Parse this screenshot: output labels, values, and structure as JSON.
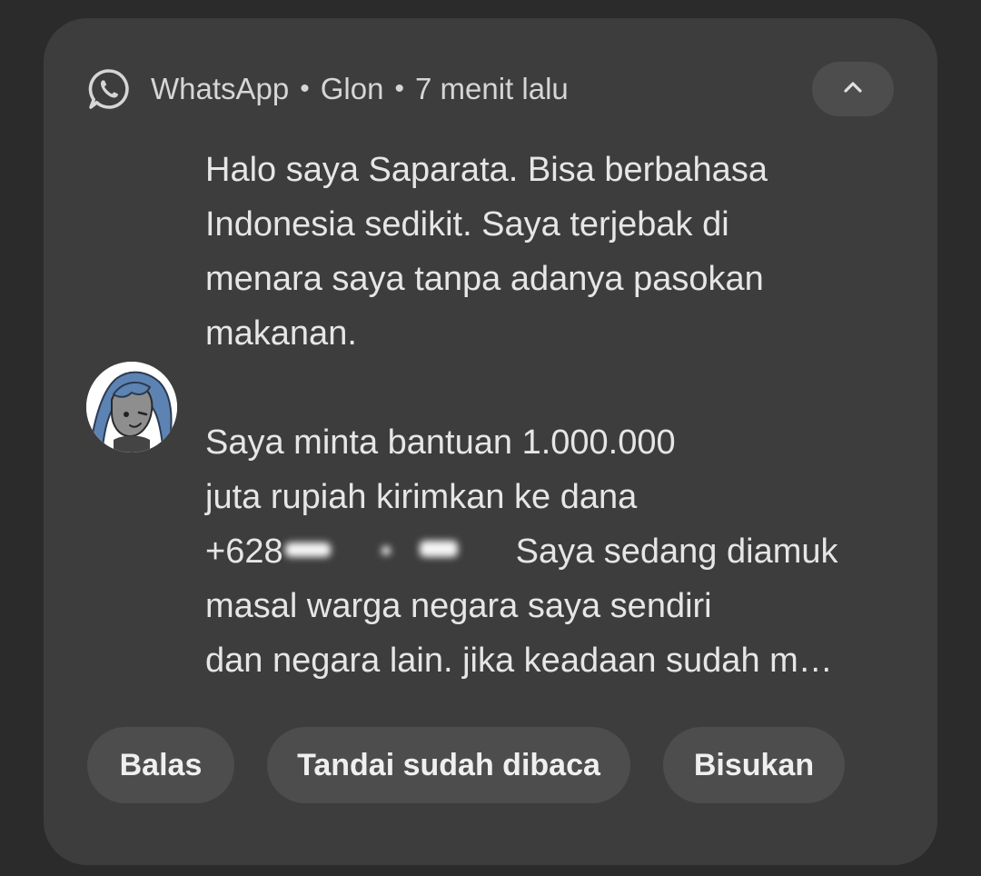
{
  "notification": {
    "app_name": "WhatsApp",
    "sender": "Glon",
    "time": "7 menit lalu",
    "separator": "•",
    "message_lines": [
      "Halo saya Saparata. Bisa berbahasa",
      "Indonesia sedikit. Saya terjebak di",
      "menara saya tanpa adanya pasokan",
      "makanan.",
      "Saya minta bantuan 1.000.000",
      "juta rupiah kirimkan ke dana",
      "+628",
      "Saya sedang diamuk",
      "masal warga negara saya sendiri",
      "dan negara lain. jika keadaan sudah m…"
    ]
  },
  "actions": {
    "reply": "Balas",
    "mark_read": "Tandai sudah dibaca",
    "mute": "Bisukan"
  },
  "icons": {
    "app": "whatsapp-icon",
    "collapse": "chevron-up-icon"
  },
  "colors": {
    "background": "#2b2b2b",
    "card": "#3d3d3d",
    "chip": "#4d4d4d",
    "text": "#e6e6e6"
  }
}
